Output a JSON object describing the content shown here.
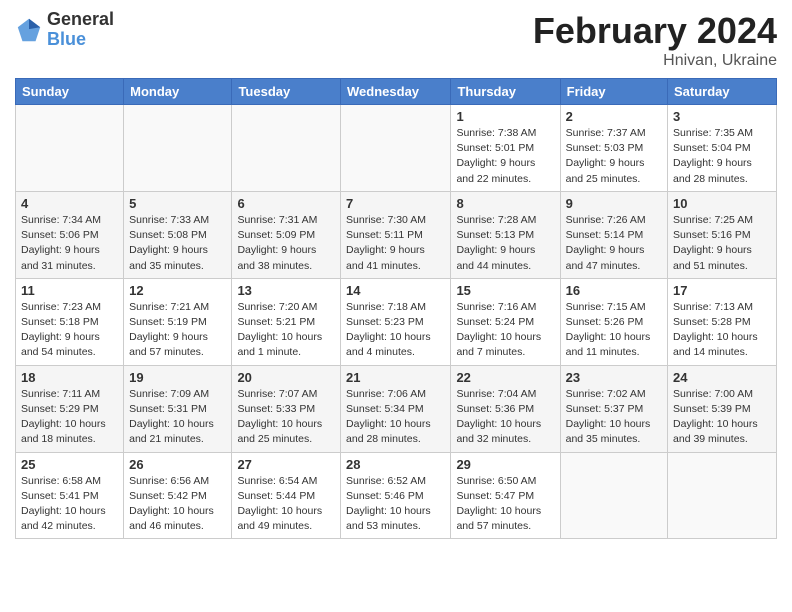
{
  "header": {
    "logo_general": "General",
    "logo_blue": "Blue",
    "title": "February 2024",
    "location": "Hnivan, Ukraine"
  },
  "days_of_week": [
    "Sunday",
    "Monday",
    "Tuesday",
    "Wednesday",
    "Thursday",
    "Friday",
    "Saturday"
  ],
  "weeks": [
    [
      {
        "day": "",
        "info": ""
      },
      {
        "day": "",
        "info": ""
      },
      {
        "day": "",
        "info": ""
      },
      {
        "day": "",
        "info": ""
      },
      {
        "day": "1",
        "info": "Sunrise: 7:38 AM\nSunset: 5:01 PM\nDaylight: 9 hours\nand 22 minutes."
      },
      {
        "day": "2",
        "info": "Sunrise: 7:37 AM\nSunset: 5:03 PM\nDaylight: 9 hours\nand 25 minutes."
      },
      {
        "day": "3",
        "info": "Sunrise: 7:35 AM\nSunset: 5:04 PM\nDaylight: 9 hours\nand 28 minutes."
      }
    ],
    [
      {
        "day": "4",
        "info": "Sunrise: 7:34 AM\nSunset: 5:06 PM\nDaylight: 9 hours\nand 31 minutes."
      },
      {
        "day": "5",
        "info": "Sunrise: 7:33 AM\nSunset: 5:08 PM\nDaylight: 9 hours\nand 35 minutes."
      },
      {
        "day": "6",
        "info": "Sunrise: 7:31 AM\nSunset: 5:09 PM\nDaylight: 9 hours\nand 38 minutes."
      },
      {
        "day": "7",
        "info": "Sunrise: 7:30 AM\nSunset: 5:11 PM\nDaylight: 9 hours\nand 41 minutes."
      },
      {
        "day": "8",
        "info": "Sunrise: 7:28 AM\nSunset: 5:13 PM\nDaylight: 9 hours\nand 44 minutes."
      },
      {
        "day": "9",
        "info": "Sunrise: 7:26 AM\nSunset: 5:14 PM\nDaylight: 9 hours\nand 47 minutes."
      },
      {
        "day": "10",
        "info": "Sunrise: 7:25 AM\nSunset: 5:16 PM\nDaylight: 9 hours\nand 51 minutes."
      }
    ],
    [
      {
        "day": "11",
        "info": "Sunrise: 7:23 AM\nSunset: 5:18 PM\nDaylight: 9 hours\nand 54 minutes."
      },
      {
        "day": "12",
        "info": "Sunrise: 7:21 AM\nSunset: 5:19 PM\nDaylight: 9 hours\nand 57 minutes."
      },
      {
        "day": "13",
        "info": "Sunrise: 7:20 AM\nSunset: 5:21 PM\nDaylight: 10 hours\nand 1 minute."
      },
      {
        "day": "14",
        "info": "Sunrise: 7:18 AM\nSunset: 5:23 PM\nDaylight: 10 hours\nand 4 minutes."
      },
      {
        "day": "15",
        "info": "Sunrise: 7:16 AM\nSunset: 5:24 PM\nDaylight: 10 hours\nand 7 minutes."
      },
      {
        "day": "16",
        "info": "Sunrise: 7:15 AM\nSunset: 5:26 PM\nDaylight: 10 hours\nand 11 minutes."
      },
      {
        "day": "17",
        "info": "Sunrise: 7:13 AM\nSunset: 5:28 PM\nDaylight: 10 hours\nand 14 minutes."
      }
    ],
    [
      {
        "day": "18",
        "info": "Sunrise: 7:11 AM\nSunset: 5:29 PM\nDaylight: 10 hours\nand 18 minutes."
      },
      {
        "day": "19",
        "info": "Sunrise: 7:09 AM\nSunset: 5:31 PM\nDaylight: 10 hours\nand 21 minutes."
      },
      {
        "day": "20",
        "info": "Sunrise: 7:07 AM\nSunset: 5:33 PM\nDaylight: 10 hours\nand 25 minutes."
      },
      {
        "day": "21",
        "info": "Sunrise: 7:06 AM\nSunset: 5:34 PM\nDaylight: 10 hours\nand 28 minutes."
      },
      {
        "day": "22",
        "info": "Sunrise: 7:04 AM\nSunset: 5:36 PM\nDaylight: 10 hours\nand 32 minutes."
      },
      {
        "day": "23",
        "info": "Sunrise: 7:02 AM\nSunset: 5:37 PM\nDaylight: 10 hours\nand 35 minutes."
      },
      {
        "day": "24",
        "info": "Sunrise: 7:00 AM\nSunset: 5:39 PM\nDaylight: 10 hours\nand 39 minutes."
      }
    ],
    [
      {
        "day": "25",
        "info": "Sunrise: 6:58 AM\nSunset: 5:41 PM\nDaylight: 10 hours\nand 42 minutes."
      },
      {
        "day": "26",
        "info": "Sunrise: 6:56 AM\nSunset: 5:42 PM\nDaylight: 10 hours\nand 46 minutes."
      },
      {
        "day": "27",
        "info": "Sunrise: 6:54 AM\nSunset: 5:44 PM\nDaylight: 10 hours\nand 49 minutes."
      },
      {
        "day": "28",
        "info": "Sunrise: 6:52 AM\nSunset: 5:46 PM\nDaylight: 10 hours\nand 53 minutes."
      },
      {
        "day": "29",
        "info": "Sunrise: 6:50 AM\nSunset: 5:47 PM\nDaylight: 10 hours\nand 57 minutes."
      },
      {
        "day": "",
        "info": ""
      },
      {
        "day": "",
        "info": ""
      }
    ]
  ]
}
